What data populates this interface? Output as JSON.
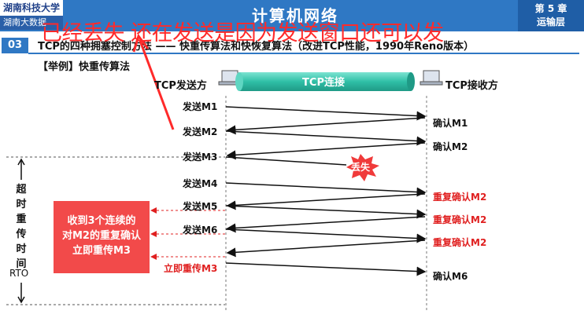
{
  "header": {
    "logo_text": "湖南科技大学",
    "logo_sub": "湖南大数据",
    "title": "计算机网络",
    "chapter": "第 5 章",
    "chapter_sub": "运输层"
  },
  "overlay_text": "已经丢失 还在发送是因为发送窗口还可以发",
  "section": {
    "number": "03",
    "title": "TCP的四种拥塞控制方法 —— 快重传算法和快恢复算法（改进TCP性能，1990年Reno版本）"
  },
  "example": "【举例】快重传算法",
  "sender": "TCP发送方",
  "receiver": "TCP接收方",
  "connection": "TCP连接",
  "sends": [
    "发送M1",
    "发送M2",
    "发送M3",
    "发送M4",
    "发送M5",
    "发送M6"
  ],
  "acks": [
    "确认M1",
    "确认M2",
    "重复确认M2",
    "重复确认M2",
    "重复确认M2",
    "确认M6"
  ],
  "lost_label": "丢失",
  "retransmit": "立即重传M3",
  "note": [
    "收到3个连续的",
    "对M2的重复确认",
    "立即重传M3"
  ],
  "rto_chars": [
    "超",
    "时",
    "重",
    "传",
    "时",
    "间"
  ],
  "rto_label": "RTO",
  "colors": {
    "header": "#2f78c4",
    "accent_red": "#e02020",
    "note_bg": "#f24a4a",
    "pipe": "#35c9b0"
  }
}
